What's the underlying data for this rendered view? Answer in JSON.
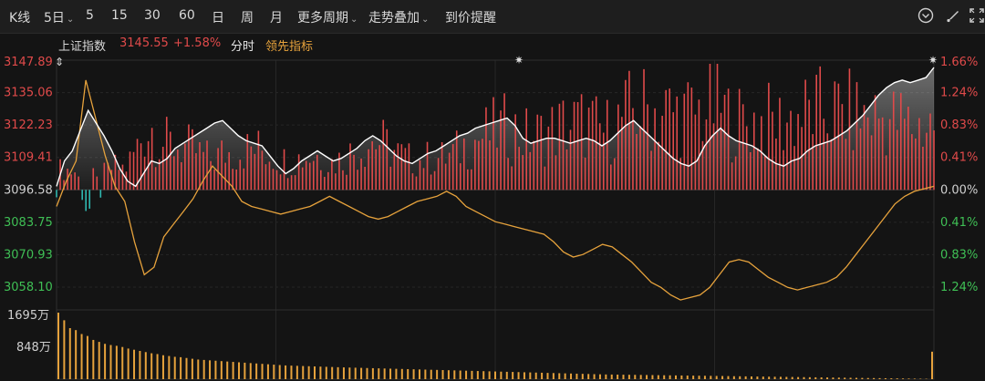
{
  "toolbar": {
    "kline": "K线",
    "five_day": "5日",
    "periods": [
      "5",
      "15",
      "30",
      "60",
      "日",
      "周",
      "月"
    ],
    "more_periods": "更多周期",
    "overlay": "走势叠加",
    "price_alert": "到价提醒"
  },
  "info": {
    "index_name": "上证指数",
    "price": "3145.55",
    "change_pct": "+1.58%",
    "tab_timeshare": "分时",
    "tab_leading": "领先指标"
  },
  "colors": {
    "up": "#e04a4a",
    "down": "#2fb8b0",
    "price_line": "#ffffff",
    "lead_line": "#e6a23c",
    "volume": "#e6a23c"
  },
  "chart_data": {
    "type": "line",
    "y_left_ticks": [
      "3147.89",
      "3135.06",
      "3122.23",
      "3109.41",
      "3096.58",
      "3083.75",
      "3070.93",
      "3058.10"
    ],
    "y_right_ticks": [
      "1.66%",
      "1.24%",
      "0.83%",
      "0.41%",
      "0.00%",
      "0.41%",
      "0.83%",
      "1.24%"
    ],
    "ylim": [
      3058.1,
      3147.89
    ],
    "base": 3096.58,
    "volume_ticks": [
      "1695万",
      "848万"
    ],
    "volume_max": 1695,
    "series": [
      {
        "values": [
          3098,
          3108,
          3112,
          3120,
          3128,
          3123,
          3118,
          3112,
          3105,
          3100,
          3098,
          3103,
          3108,
          3107,
          3109,
          3113,
          3115,
          3117,
          3119,
          3121,
          3123,
          3124,
          3121,
          3118,
          3116,
          3115,
          3114,
          3110,
          3106,
          3103,
          3105,
          3108,
          3110,
          3112,
          3110,
          3108,
          3109,
          3111,
          3113,
          3116,
          3118,
          3116,
          3113,
          3110,
          3108,
          3107,
          3109,
          3111,
          3112,
          3114,
          3116,
          3118,
          3119,
          3121,
          3122,
          3123,
          3124,
          3125,
          3122,
          3117,
          3115,
          3116,
          3117,
          3117,
          3116,
          3115,
          3116,
          3117,
          3116,
          3114,
          3116,
          3119,
          3122,
          3124,
          3121,
          3118,
          3115,
          3112,
          3109,
          3107,
          3106,
          3108,
          3114,
          3118,
          3121,
          3118,
          3116,
          3115,
          3114,
          3112,
          3109,
          3107,
          3106,
          3108,
          3109,
          3112,
          3114,
          3115,
          3116,
          3118,
          3120,
          3123,
          3126,
          3130,
          3134,
          3137,
          3139,
          3140,
          3139,
          3140,
          3141,
          3145
        ]
      },
      {
        "values": [
          3090,
          3100,
          3108,
          3140,
          3125,
          3110,
          3098,
          3092,
          3076,
          3063,
          3066,
          3078,
          3083,
          3088,
          3093,
          3100,
          3106,
          3102,
          3098,
          3092,
          3090,
          3089,
          3088,
          3087,
          3088,
          3089,
          3090,
          3092,
          3094,
          3092,
          3090,
          3088,
          3086,
          3085,
          3086,
          3088,
          3090,
          3092,
          3093,
          3094,
          3096,
          3094,
          3090,
          3088,
          3086,
          3084,
          3083,
          3082,
          3081,
          3080,
          3079,
          3076,
          3072,
          3070,
          3071,
          3073,
          3075,
          3074,
          3071,
          3068,
          3064,
          3060,
          3058,
          3055,
          3053,
          3054,
          3055,
          3058,
          3063,
          3068,
          3069,
          3068,
          3065,
          3062,
          3060,
          3058,
          3057,
          3058,
          3059,
          3060,
          3062,
          3066,
          3071,
          3076,
          3081,
          3086,
          3091,
          3094,
          3096,
          3097,
          3098
        ]
      }
    ],
    "volume": [
      1695,
      1500,
      1300,
      1250,
      1150,
      1100,
      1000,
      950,
      900,
      870,
      850,
      820,
      780,
      750,
      720,
      690,
      660,
      640,
      610,
      590,
      570,
      560,
      540,
      520,
      500,
      490,
      480,
      470,
      460,
      450,
      440,
      430,
      420,
      410,
      400,
      390,
      380,
      370,
      360,
      350,
      345,
      340,
      335,
      330,
      325,
      320,
      315,
      310,
      305,
      300,
      296,
      292,
      288,
      284,
      280,
      276,
      272,
      268,
      264,
      260,
      256,
      252,
      248,
      244,
      240,
      236,
      232,
      228,
      224,
      220,
      216,
      212,
      208,
      204,
      200,
      196,
      192,
      188,
      184,
      180,
      176,
      172,
      168,
      164,
      160,
      156,
      152,
      148,
      144,
      140,
      136,
      132,
      128,
      124,
      120,
      118,
      116,
      114,
      112,
      110,
      108,
      106,
      104,
      102,
      100,
      98,
      96,
      94,
      92,
      90,
      88,
      86,
      84,
      82,
      80,
      78,
      76,
      74,
      72,
      70,
      68,
      66,
      64,
      62,
      60,
      58,
      56,
      54,
      52,
      50,
      48,
      46,
      44,
      42,
      40,
      38,
      36,
      34,
      32,
      30,
      28,
      26,
      24,
      22,
      20,
      18,
      16,
      14,
      12,
      10,
      700
    ]
  }
}
